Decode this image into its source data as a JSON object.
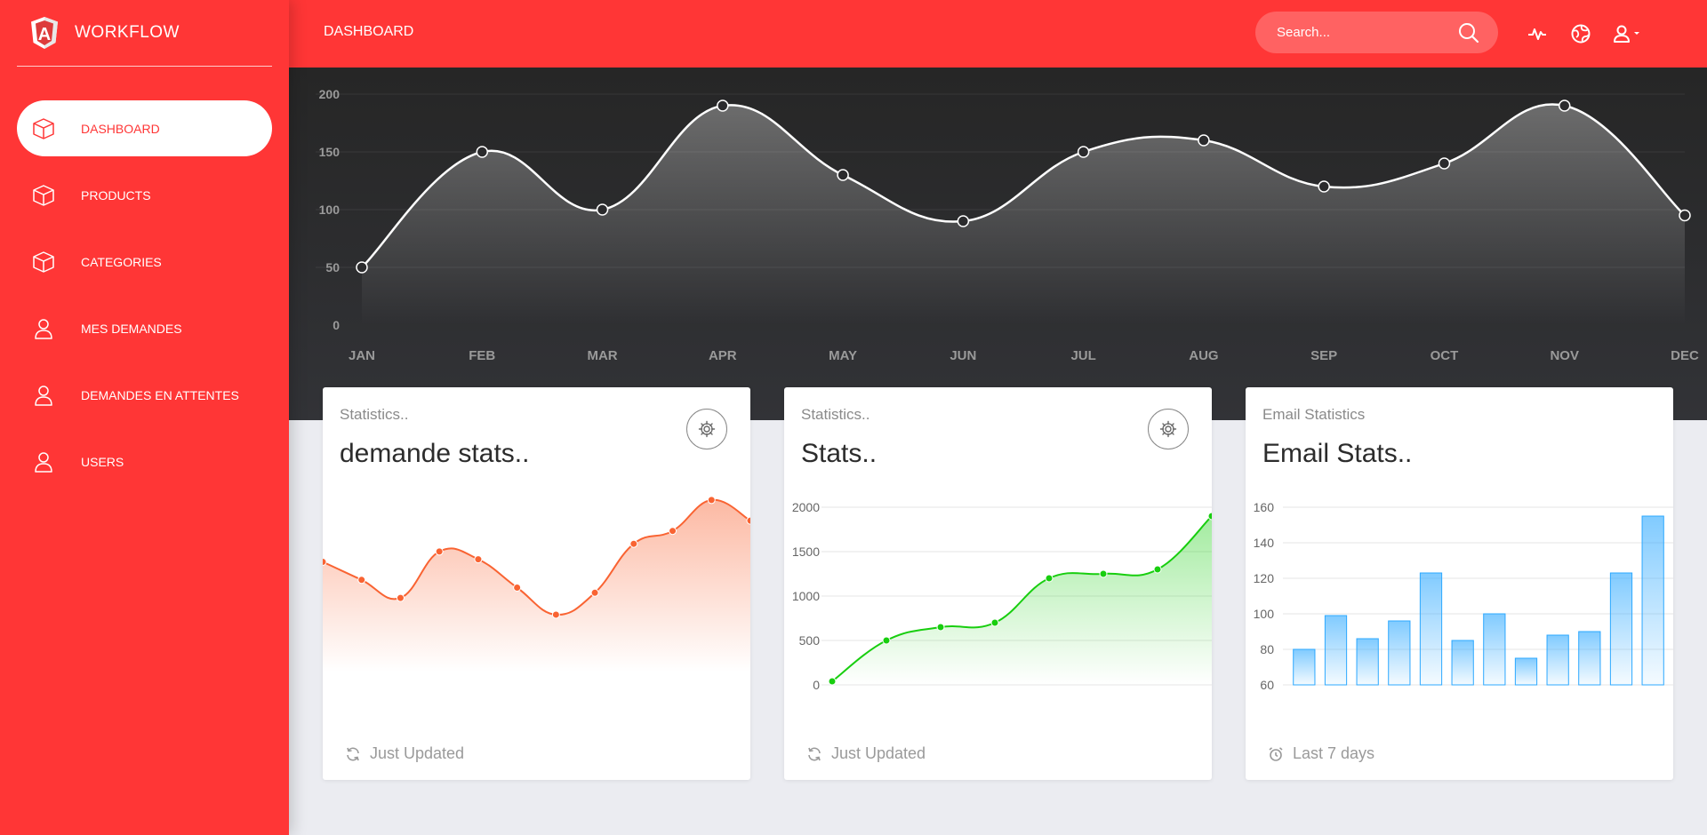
{
  "app": {
    "title": "WORKFLOW",
    "logo_letter": "A",
    "accent": "#ff3636"
  },
  "sidebar": {
    "items": [
      {
        "label": "DASHBOARD",
        "icon": "cube-icon",
        "active": true
      },
      {
        "label": "PRODUCTS",
        "icon": "cube-icon",
        "active": false
      },
      {
        "label": "CATEGORIES",
        "icon": "cube-icon",
        "active": false
      },
      {
        "label": "MES DEMANDES",
        "icon": "user-icon",
        "active": false
      },
      {
        "label": "DEMANDES EN ATTENTES",
        "icon": "user-icon",
        "active": false
      },
      {
        "label": "USERS",
        "icon": "user-icon",
        "active": false
      }
    ]
  },
  "header": {
    "title": "DASHBOARD",
    "search_placeholder": "Search...",
    "icons": [
      "activity-icon",
      "globe-icon",
      "user-dropdown-icon"
    ]
  },
  "cards": [
    {
      "category": "Statistics..",
      "title": "demande stats..",
      "footer": "Just Updated",
      "footer_icon": "refresh-icon",
      "has_gear": true
    },
    {
      "category": "Statistics..",
      "title": "Stats..",
      "footer": "Just Updated",
      "footer_icon": "refresh-icon",
      "has_gear": true
    },
    {
      "category": "Email Statistics",
      "title": "Email Stats..",
      "footer": "Last 7 days",
      "footer_icon": "alarm-icon",
      "has_gear": false
    }
  ],
  "chart_data": [
    {
      "type": "area",
      "categories": [
        "JAN",
        "FEB",
        "MAR",
        "APR",
        "MAY",
        "JUN",
        "JUL",
        "AUG",
        "SEP",
        "OCT",
        "NOV",
        "DEC"
      ],
      "values": [
        50,
        150,
        100,
        190,
        130,
        90,
        150,
        160,
        120,
        140,
        190,
        95
      ],
      "ylim": [
        0,
        200
      ],
      "yticks": [
        0,
        50,
        100,
        150,
        200
      ],
      "grid": true,
      "color": "#ffffff"
    },
    {
      "type": "area",
      "values": [
        110,
        96,
        82,
        118,
        112,
        90,
        69,
        86,
        124,
        134,
        158,
        142
      ],
      "color": "#f96332"
    },
    {
      "type": "area",
      "values": [
        40,
        500,
        650,
        700,
        1200,
        1250,
        1300,
        1900
      ],
      "ylim": [
        0,
        2000
      ],
      "yticks": [
        0,
        500,
        1000,
        1500,
        2000
      ],
      "grid": true,
      "color": "#18ce0f"
    },
    {
      "type": "bar",
      "values": [
        80,
        99,
        86,
        96,
        123,
        85,
        100,
        75,
        88,
        90,
        123,
        155
      ],
      "ylim": [
        60,
        160
      ],
      "yticks": [
        60,
        80,
        100,
        120,
        140,
        160
      ],
      "grid": true,
      "color": "#2ca8ff"
    }
  ]
}
